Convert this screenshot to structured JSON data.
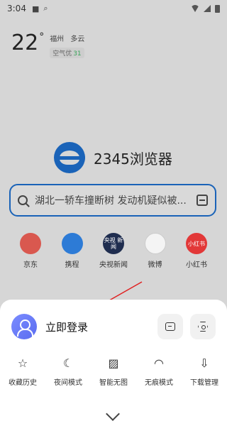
{
  "status": {
    "time": "3:04"
  },
  "weather": {
    "temp": "22",
    "deg": "°",
    "city": "福州",
    "condition": "多云",
    "aqi_label": "空气优",
    "aqi_value": "31"
  },
  "logo": {
    "text": "2345浏览器"
  },
  "search": {
    "text": "湖北一轿车撞断树 发动机疑似被..."
  },
  "apps": [
    {
      "label": "京东",
      "icon": "jd-icon",
      "color": "#d9584f",
      "glyph": ""
    },
    {
      "label": "携程",
      "icon": "ctrip-icon",
      "color": "#2d7bd6",
      "glyph": ""
    },
    {
      "label": "央视新闻",
      "icon": "cctv-news-icon",
      "color": "#1f2d4f",
      "glyph": "央视\n新闻"
    },
    {
      "label": "微博",
      "icon": "weibo-icon",
      "color": "#f4f4f4",
      "glyph": ""
    },
    {
      "label": "小红书",
      "icon": "xiaohongshu-icon",
      "color": "#e23838",
      "glyph": "小红书"
    }
  ],
  "sheet": {
    "login": "立即登录",
    "tools": [
      {
        "label": "收藏历史",
        "icon": "star-icon",
        "glyph": "☆"
      },
      {
        "label": "夜间模式",
        "icon": "moon-icon",
        "glyph": "☾"
      },
      {
        "label": "智能无图",
        "icon": "no-image-icon",
        "glyph": "▨"
      },
      {
        "label": "无痕模式",
        "icon": "ghost-icon",
        "glyph": "◠"
      },
      {
        "label": "下载管理",
        "icon": "download-icon",
        "glyph": "⇩"
      }
    ]
  },
  "colors": {
    "accent": "#1a63b8",
    "annotation": "#e02020"
  }
}
